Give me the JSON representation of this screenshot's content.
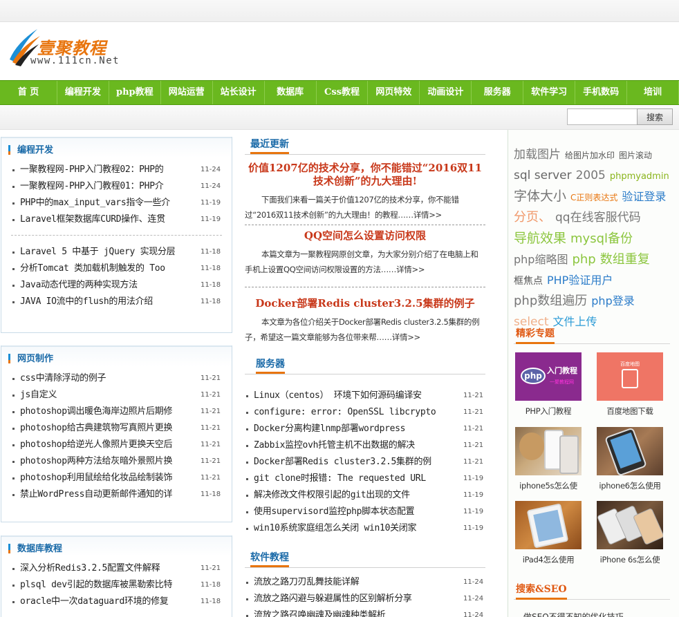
{
  "logo": {
    "cn": "壹聚教程",
    "en": "www.111cn.Net"
  },
  "nav": [
    "首 页",
    "编程开发",
    "php教程",
    "网站运营",
    "站长设计",
    "数据库",
    "Css教程",
    "网页特效",
    "动画设计",
    "服务器",
    "软件学习",
    "手机数码",
    "培训"
  ],
  "search": {
    "value": "",
    "button": "搜索"
  },
  "left": [
    {
      "title": "编程开发",
      "groups": [
        [
          {
            "t": "一聚教程网-PHP入门教程02：PHP的",
            "d": "11-24"
          },
          {
            "t": "一聚教程网-PHP入门教程01：PHP介",
            "d": "11-24"
          },
          {
            "t": "PHP中的max_input_vars指令一些介",
            "d": "11-19"
          },
          {
            "t": "Laravel框架数据库CURD操作、连贯",
            "d": "11-19"
          }
        ],
        [
          {
            "t": "Laravel 5 中基于 jQuery 实现分层",
            "d": "11-18"
          },
          {
            "t": "分析Tomcat 类加载机制触发的 Too",
            "d": "11-18"
          },
          {
            "t": "Java动态代理的两种实现方法",
            "d": "11-18"
          },
          {
            "t": "JAVA IO流中的flush的用法介绍",
            "d": "11-18"
          }
        ]
      ]
    },
    {
      "title": "网页制作",
      "items": [
        {
          "t": "css中清除浮动的例子",
          "d": "11-21"
        },
        {
          "t": "js自定义",
          "d": "11-21"
        },
        {
          "t": "photoshop调出暖色海岸边照片后期修",
          "d": "11-21"
        },
        {
          "t": "photoshop给古典建筑物写真照片更换",
          "d": "11-21"
        },
        {
          "t": "photoshop给逆光人像照片更换天空后",
          "d": "11-21"
        },
        {
          "t": "photoshop两种方法给灰暗外景照片换",
          "d": "11-21"
        },
        {
          "t": "photoshop利用鼠绘给化妆品绘制装饰",
          "d": "11-21"
        },
        {
          "t": "禁止WordPress自动更新邮件通知的详",
          "d": "11-18"
        }
      ]
    },
    {
      "title": "数据库教程",
      "items": [
        {
          "t": "深入分析Redis3.2.5配置文件解释",
          "d": "11-21"
        },
        {
          "t": "plsql dev引起的数据库被黑勒索比特",
          "d": "11-18"
        },
        {
          "t": "oracle中一次dataguard环境的修复",
          "d": "11-18"
        }
      ]
    }
  ],
  "middle": {
    "latest_title": "最近更新",
    "articles": [
      {
        "title": "价值1207亿的技术分享，你不能错过“2016双11技术创新”的九大理由!",
        "body": "下面我们来看一篇关于价值1207亿的技术分享，你不能错过“2016双11技术创新”的九大理由！的教程",
        "more": "……详情>>"
      },
      {
        "title": "QQ空间怎么设置访问权限",
        "body": "本篇文章为一聚教程网原创文章，为大家分别介绍了在电脑上和手机上设置QQ空间访问权限设置的方法",
        "more": "……详情>>"
      },
      {
        "title": "Docker部署Redis cluster3.2.5集群的例子",
        "body": "本文章为各位介绍关于Docker部署Redis cluster3.2.5集群的例子，希望这一篇文章能够为各位带来帮",
        "more": "……详情>>"
      }
    ],
    "server_title": "服务器",
    "server_items": [
      {
        "t": "Linux（centos） 环境下如何源码编译安",
        "d": "11-21"
      },
      {
        "t": "configure: error: OpenSSL libcrypto",
        "d": "11-21"
      },
      {
        "t": "Docker分离构建lnmp部署wordpress",
        "d": "11-21"
      },
      {
        "t": "Zabbix监控ovh托管主机不出数据的解决",
        "d": "11-21"
      },
      {
        "t": "Docker部署Redis cluster3.2.5集群的例",
        "d": "11-21"
      },
      {
        "t": "git clone时报错: The requested URL",
        "d": "11-19"
      },
      {
        "t": "解决修改文件权限引起的git出现的文件",
        "d": "11-19"
      },
      {
        "t": "使用supervisord监控php脚本状态配置",
        "d": "11-19"
      },
      {
        "t": "win10系统家庭组怎么关闭 win10关闭家",
        "d": "11-19"
      }
    ],
    "soft_title": "软件教程",
    "soft_items": [
      {
        "t": "流放之路刀刃乱舞技能详解",
        "d": "11-24"
      },
      {
        "t": "流放之路闪避与躲避属性的区别解析分享",
        "d": "11-24"
      },
      {
        "t": "流放之路召唤幽魂及幽魂种类解析",
        "d": "11-24"
      }
    ]
  },
  "right": {
    "tags": [
      {
        "t": "加载图片",
        "c": "#777777",
        "s": 17
      },
      {
        "t": "给图片加水印",
        "c": "#555555",
        "s": 12
      },
      {
        "t": "图片滚动",
        "c": "#555555",
        "s": 12
      },
      {
        "t": "sql server",
        "c": "#666666",
        "s": 17
      },
      {
        "t": "2005",
        "c": "#777777",
        "s": 17
      },
      {
        "t": "phpmyadmin",
        "c": "#8ab51c",
        "s": 13
      },
      {
        "t": "字体大小",
        "c": "#777777",
        "s": 19
      },
      {
        "t": "C正则表达式",
        "c": "#e8750e",
        "s": 12
      },
      {
        "t": "验证登录",
        "c": "#2b7cc9",
        "s": 16
      },
      {
        "t": "分页、",
        "c": "#f0986a",
        "s": 18
      },
      {
        "t": "qq在线客服代码",
        "c": "#777777",
        "s": 17
      },
      {
        "t": "导航效果",
        "c": "#8cc63f",
        "s": 19
      },
      {
        "t": "mysql备份",
        "c": "#8cc63f",
        "s": 18
      },
      {
        "t": "php缩略图",
        "c": "#777777",
        "s": 16
      },
      {
        "t": "php",
        "c": "#8cc63f",
        "s": 18
      },
      {
        "t": "数组重复",
        "c": "#8cc63f",
        "s": 18
      },
      {
        "t": "框焦点",
        "c": "#555555",
        "s": 14
      },
      {
        "t": "PHP验证用户",
        "c": "#2b7cc9",
        "s": 16
      },
      {
        "t": "php数组遍历",
        "c": "#777777",
        "s": 18
      },
      {
        "t": "php登录",
        "c": "#2b7cc9",
        "s": 16
      },
      {
        "t": "select",
        "c": "#f0b08a",
        "s": 17
      },
      {
        "t": "文件上传",
        "c": "#2b9bd6",
        "s": 16
      }
    ],
    "topics_title": "精彩专题",
    "topics": [
      {
        "cap": "PHP入门教程",
        "badge": "入门教程",
        "sub": "一聚教程网",
        "logo": "php"
      },
      {
        "cap": "百度地图下载",
        "badge": "百度地图"
      },
      {
        "cap": "iphone5s怎么使"
      },
      {
        "cap": "iphone6怎么使用"
      },
      {
        "cap": "iPad4怎么使用"
      },
      {
        "cap": "iPhone 6s怎么使"
      }
    ],
    "seo_title": "搜索&SEO",
    "seo_items": [
      "做SEO不得不知的优化技巧"
    ]
  }
}
